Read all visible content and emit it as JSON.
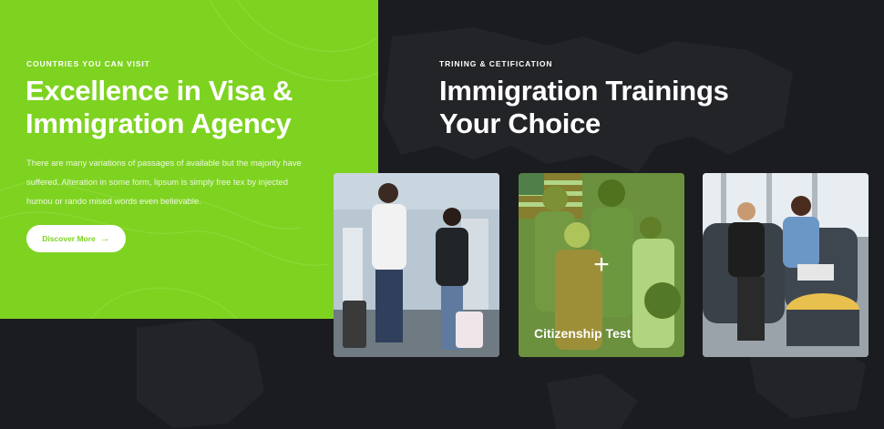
{
  "left": {
    "eyebrow": "COUNTRIES YOU CAN VISIT",
    "title_line1": "Excellence in Visa &",
    "title_line2": "Immigration Agency",
    "description": "There are many variations of passages of available but the majority have suffered. Alteration in some form, lipsum is simply free tex by injected humou or rando mised words even believable.",
    "button_label": "Discover More",
    "button_icon": "arrow-right-icon"
  },
  "right": {
    "eyebrow": "TRINING & CETIFICATION",
    "title_line1": "Immigration Trainings",
    "title_line2": "Your Choice"
  },
  "cards": [
    {
      "image": "travelers-at-airport"
    },
    {
      "image": "citizenship-group",
      "label": "Citizenship Test",
      "icon": "plus-icon"
    },
    {
      "image": "office-meeting"
    }
  ],
  "colors": {
    "accent": "#7ed321",
    "background": "#1b1c1f",
    "text": "#ffffff"
  }
}
